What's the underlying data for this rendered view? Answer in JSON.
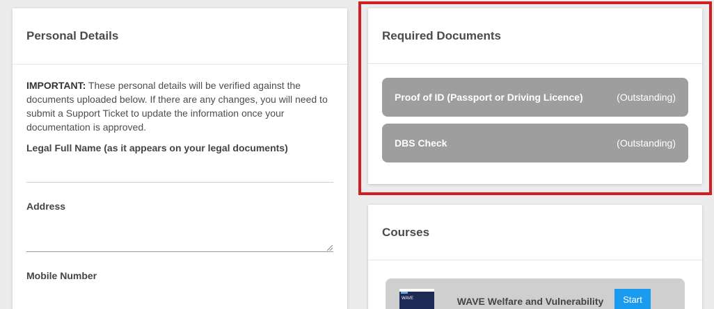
{
  "personal_details": {
    "title": "Personal Details",
    "notice_strong": "IMPORTANT:",
    "notice_text": " These personal details will be verified against the documents uploaded below. If there are any changes, you will need to submit a Support Ticket to update the information once your documentation is approved.",
    "legal_name_label": "Legal Full Name (as it appears on your legal documents)",
    "address_label": "Address",
    "mobile_label": "Mobile Number"
  },
  "required_documents": {
    "title": "Required Documents",
    "items": [
      {
        "name": "Proof of ID (Passport or Driving Licence)",
        "status": "(Outstanding)"
      },
      {
        "name": "DBS Check",
        "status": "(Outstanding)"
      }
    ]
  },
  "courses": {
    "title": "Courses",
    "items": [
      {
        "title": "WAVE Welfare and Vulnerability Engagement",
        "thumb_text": "WAVE",
        "action": "Start"
      }
    ]
  },
  "colors": {
    "highlight": "#d11f1f",
    "doc_item_bg": "#9e9e9e",
    "start_button": "#1a9bf0"
  }
}
